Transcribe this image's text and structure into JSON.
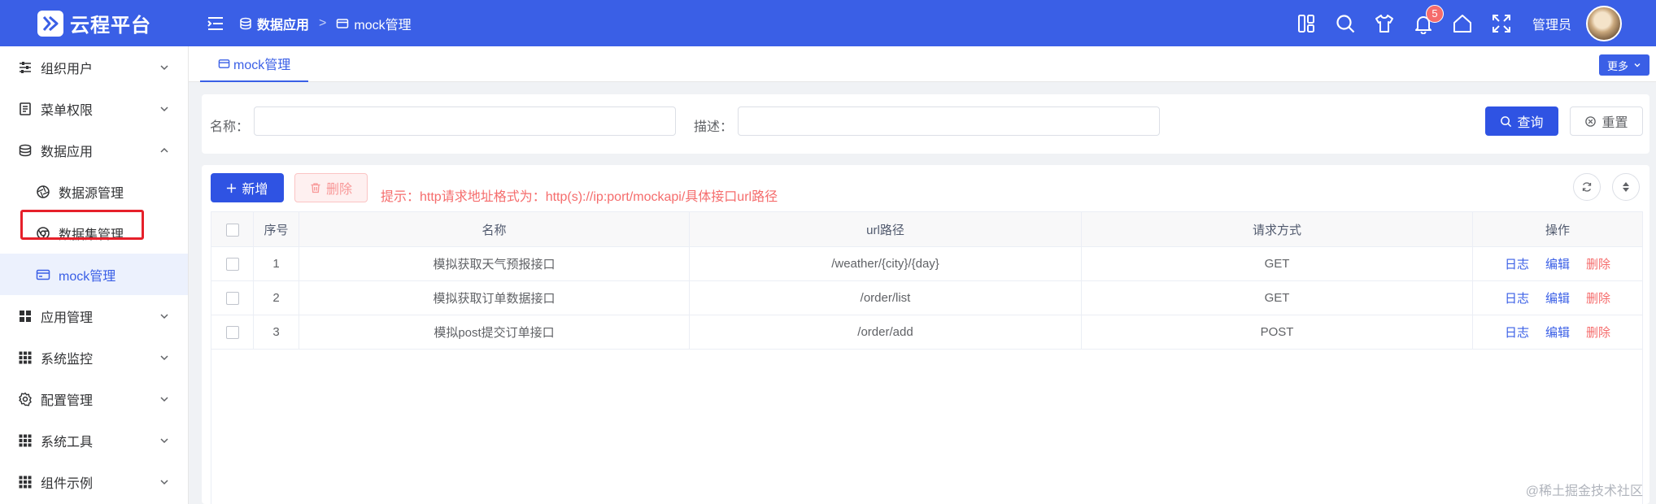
{
  "brand": {
    "name": "云程平台"
  },
  "header": {
    "breadcrumb": [
      "数据应用",
      "mock管理"
    ],
    "notification_count": "5",
    "username": "管理员"
  },
  "sidebar": {
    "items": [
      {
        "label": "组织用户",
        "icon": "sliders-icon"
      },
      {
        "label": "菜单权限",
        "icon": "document-icon"
      },
      {
        "label": "数据应用",
        "icon": "database-icon",
        "expanded": true
      },
      {
        "label": "数据源管理",
        "icon": "aperture-icon",
        "sub": true
      },
      {
        "label": "数据集管理",
        "icon": "chrome-icon",
        "sub": true
      },
      {
        "label": "mock管理",
        "icon": "card-icon",
        "sub": true,
        "active": true
      },
      {
        "label": "应用管理",
        "icon": "grid-icon"
      },
      {
        "label": "系统监控",
        "icon": "grid-icon"
      },
      {
        "label": "配置管理",
        "icon": "gear-icon"
      },
      {
        "label": "系统工具",
        "icon": "grid-icon"
      },
      {
        "label": "组件示例",
        "icon": "grid-icon"
      }
    ]
  },
  "tabs": {
    "active": "mock管理",
    "more": "更多"
  },
  "search": {
    "name_label": "名称：",
    "name_value": "",
    "desc_label": "描述：",
    "desc_value": "",
    "query_button": "查询",
    "reset_button": "重置"
  },
  "toolbar": {
    "add_button": "新增",
    "delete_button": "删除",
    "tip": "提示：http请求地址格式为：http(s)://ip:port/mockapi/具体接口url路径"
  },
  "table": {
    "columns": [
      "序号",
      "名称",
      "url路径",
      "请求方式",
      "操作"
    ],
    "rows": [
      {
        "no": "1",
        "name": "模拟获取天气预报接口",
        "url": "/weather/{city}/{day}",
        "method": "GET"
      },
      {
        "no": "2",
        "name": "模拟获取订单数据接口",
        "url": "/order/list",
        "method": "GET"
      },
      {
        "no": "3",
        "name": "模拟post提交订单接口",
        "url": "/order/add",
        "method": "POST"
      }
    ],
    "actions": {
      "log": "日志",
      "edit": "编辑",
      "delete": "删除"
    }
  },
  "watermark": "@稀土掘金技术社区",
  "colors": {
    "primary": "#3a5fe6",
    "danger": "#f56c6c",
    "highlight_box": "#e6202a"
  }
}
